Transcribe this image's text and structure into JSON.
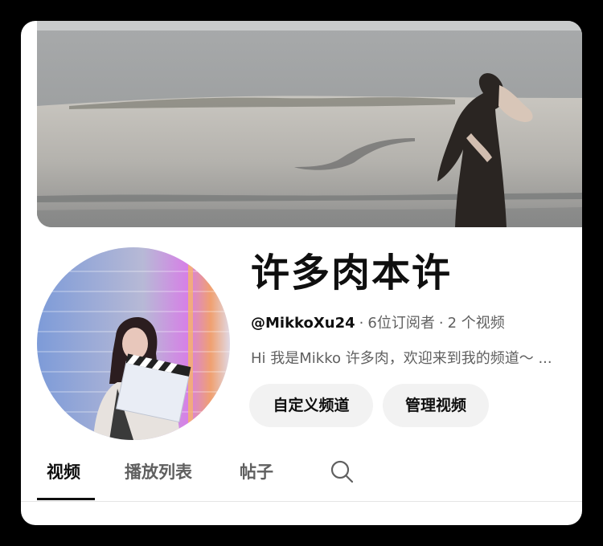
{
  "channel": {
    "name": "许多肉本许",
    "handle": "@MikkoXu24",
    "separator": "·",
    "subscribers": "6位订阅者",
    "video_count": "2 个视频",
    "description": "Hi 我是Mikko 许多肉，欢迎来到我的频道～ ..."
  },
  "actions": {
    "customize_label": "自定义频道",
    "manage_label": "管理视频"
  },
  "tabs": [
    {
      "label": "视频",
      "selected": true
    },
    {
      "label": "播放列表",
      "selected": false
    },
    {
      "label": "帖子",
      "selected": false
    }
  ],
  "icons": {
    "search": "search-icon"
  },
  "colors": {
    "text_primary": "#0f0f0f",
    "text_secondary": "#606060",
    "button_bg": "#f2f2f2",
    "frame_bg": "#ffffff"
  }
}
